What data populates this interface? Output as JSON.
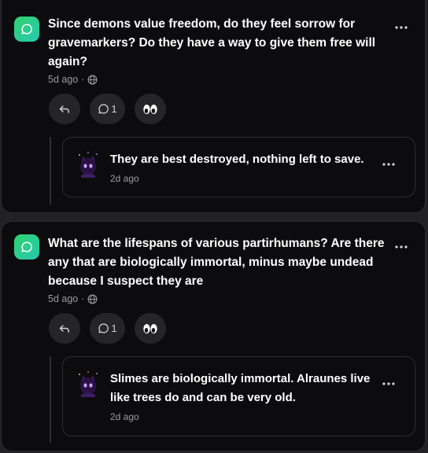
{
  "threads": [
    {
      "question": "Since demons value freedom, do they feel sorrow for gravemarkers? Do they have a way to give them free will again?",
      "age": "5d ago",
      "separator": "·",
      "comment_count": "1",
      "reply": {
        "text": "They are best destroyed, nothing left to save.",
        "age": "2d ago"
      }
    },
    {
      "question": "What are the lifespans of various partirhumans? Are there any that are biologically immortal, minus maybe undead because I suspect they are",
      "age": "5d ago",
      "separator": "·",
      "comment_count": "1",
      "reply": {
        "text": "Slimes are biologically immortal. Alraunes live like trees do and can be very old.",
        "age": "2d ago"
      }
    }
  ],
  "icons": {
    "question_avatar": "chat-bubble-icon",
    "visibility": "globe-icon",
    "reply_button": "reply-arrow-icon",
    "comment_button": "comment-icon",
    "react_button": "eyes-emoji-icon",
    "more": "more-horizontal-icon"
  },
  "colors": {
    "background": "#222225",
    "card": "#0c0c0e",
    "accent_gradient_start": "#2fd36a",
    "accent_gradient_end": "#27c8b3",
    "muted_text": "#9a9aa2"
  }
}
